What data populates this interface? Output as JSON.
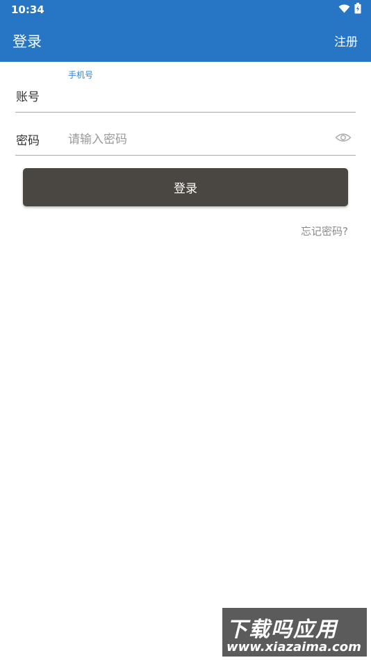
{
  "status_bar": {
    "time": "10:34"
  },
  "app_bar": {
    "title": "登录",
    "register_label": "注册"
  },
  "account": {
    "label": "账号",
    "floating_hint": "手机号",
    "value": ""
  },
  "password": {
    "label": "密码",
    "placeholder": "请输入密码"
  },
  "login_button": "登录",
  "forgot_password": "忘记密码?",
  "watermark": {
    "main": "下载吗应用",
    "url": "www.xiazaima.com"
  },
  "colors": {
    "primary": "#2676c5",
    "button": "#4a4742",
    "hint_text": "#2e82d6",
    "secondary_text": "#8a8a8a"
  },
  "icons": [
    "wifi-icon",
    "battery-icon",
    "eye-icon"
  ]
}
